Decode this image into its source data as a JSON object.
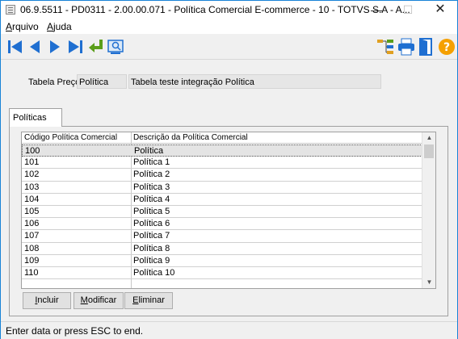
{
  "window": {
    "title": "06.9.5511 - PD0311 - 2.00.00.071 - Política Comercial E-commerce - 10 - TOTVS S.A - A...",
    "minimize_glyph": "—",
    "maximize_glyph": "☐",
    "close_glyph": "✕"
  },
  "menu": {
    "file_label": "Arquivo",
    "help_label": "Ajuda"
  },
  "toolbar": {
    "icons": [
      "first-record-icon",
      "previous-record-icon",
      "next-record-icon",
      "last-record-icon",
      "go-to-icon",
      "search-icon",
      "hierarchy-icon",
      "print-icon",
      "exit-icon",
      "help-icon"
    ],
    "accent_color": "#1f6fd1"
  },
  "header": {
    "tabela_label": "Tabela Preço:",
    "tabela_code": "Política",
    "tabela_desc": "Tabela teste integração Política"
  },
  "tab": {
    "label": "Políticas"
  },
  "grid": {
    "columns": [
      "Código Política Comercial",
      "Descrição da Política Comercial"
    ],
    "rows": [
      {
        "code": "100",
        "desc": "Política"
      },
      {
        "code": "101",
        "desc": "Política 1"
      },
      {
        "code": "102",
        "desc": "Política 2"
      },
      {
        "code": "103",
        "desc": "Política 3"
      },
      {
        "code": "104",
        "desc": "Política 4"
      },
      {
        "code": "105",
        "desc": "Política 5"
      },
      {
        "code": "106",
        "desc": "Política 6"
      },
      {
        "code": "107",
        "desc": "Política 7"
      },
      {
        "code": "108",
        "desc": "Política 8"
      },
      {
        "code": "109",
        "desc": "Política 9"
      },
      {
        "code": "110",
        "desc": "Política 10"
      },
      {
        "code": "",
        "desc": ""
      }
    ],
    "selected_row": 0
  },
  "buttons": {
    "include": "Incluir",
    "modify": "Modificar",
    "delete": "Eliminar"
  },
  "status": {
    "text": "Enter data or press ESC to end."
  }
}
